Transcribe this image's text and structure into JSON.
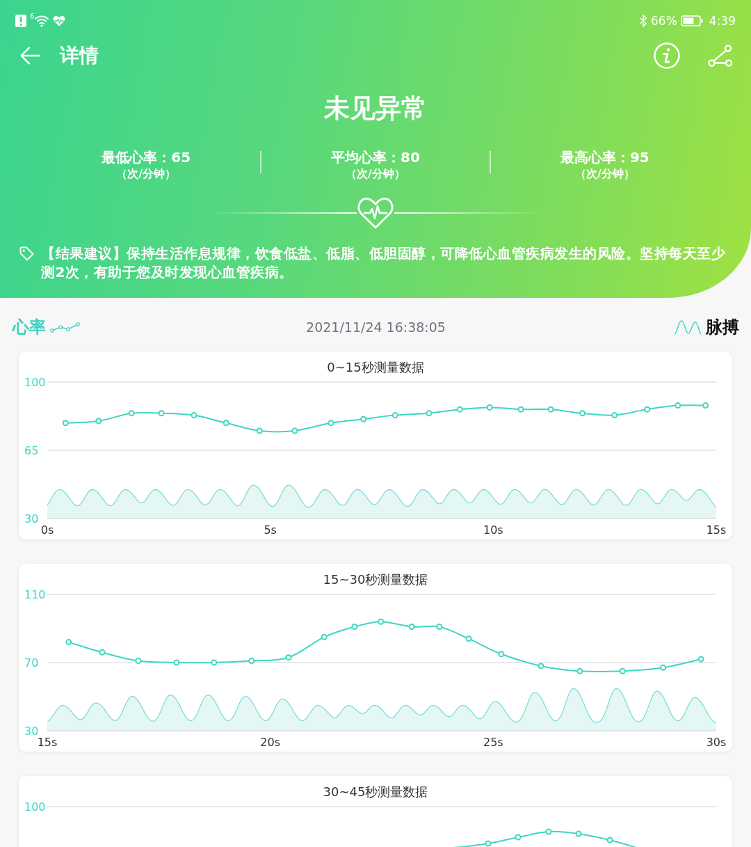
{
  "status_bar": {
    "network_badge": "6",
    "battery": "66%",
    "time": "4:39"
  },
  "title": "详情",
  "result": "未见异常",
  "stats": [
    {
      "label": "最低心率：65",
      "unit": "（次/分钟）"
    },
    {
      "label": "平均心率：80",
      "unit": "（次/分钟）"
    },
    {
      "label": "最高心率：95",
      "unit": "（次/分钟）"
    }
  ],
  "advice": "【结果建议】保持生活作息规律，饮食低盐、低脂、低胆固醇，可降低心血管疾病发生的风险。坚持每天至少测2次，有助于您及时发现心血管疾病。",
  "legend": {
    "heart_rate": "心率",
    "timestamp": "2021/11/24 16:38:05",
    "pulse": "脉搏"
  },
  "charts": [
    {
      "title": "0~15秒测量数据",
      "chart_data": {
        "type": "line",
        "x": [
          0.41,
          1.15,
          1.89,
          2.56,
          3.29,
          4.01,
          4.76,
          5.55,
          6.36,
          7.09,
          7.8,
          8.56,
          9.25,
          9.92,
          10.62,
          11.29,
          12.0,
          12.72,
          13.45,
          14.14,
          14.76
        ],
        "xlim": [
          0,
          15
        ],
        "ylim": [
          30,
          100
        ],
        "xticks": [
          {
            "value": 0,
            "label": "0s"
          },
          {
            "value": 5,
            "label": "5s"
          },
          {
            "value": 10,
            "label": "10s"
          },
          {
            "value": 15,
            "label": "15s"
          }
        ],
        "yticks": [
          30,
          65,
          100
        ],
        "series": [
          {
            "color": "#3fd6c3",
            "marker": "circle",
            "values": [
              79,
              80,
              84,
              84,
              83,
              79,
              75,
              75,
              79,
              81,
              83,
              84,
              86,
              87,
              86,
              86,
              84,
              83,
              86,
              88,
              88
            ]
          }
        ]
      }
    },
    {
      "title": "15~30秒测量数据",
      "chart_data": {
        "type": "line",
        "x": [
          15.48,
          16.23,
          17.04,
          17.9,
          18.74,
          19.58,
          20.41,
          21.21,
          21.89,
          22.48,
          23.17,
          23.79,
          24.45,
          25.18,
          26.07,
          26.94,
          27.9,
          28.81,
          29.66
        ],
        "xlim": [
          15,
          30
        ],
        "ylim": [
          30,
          110
        ],
        "xticks": [
          {
            "value": 15,
            "label": "15s"
          },
          {
            "value": 20,
            "label": "20s"
          },
          {
            "value": 25,
            "label": "25s"
          },
          {
            "value": 30,
            "label": "30s"
          }
        ],
        "yticks": [
          30,
          70,
          110
        ],
        "series": [
          {
            "color": "#3fd6c3",
            "marker": "circle",
            "values": [
              82,
              76,
              71,
              70,
              70,
              71,
              73,
              85,
              91,
              94,
              91,
              91,
              84,
              75,
              68,
              65,
              65,
              67,
              72
            ]
          }
        ]
      }
    },
    {
      "title": "30~45秒测量数据",
      "y_axis_top_label": "100"
    }
  ]
}
